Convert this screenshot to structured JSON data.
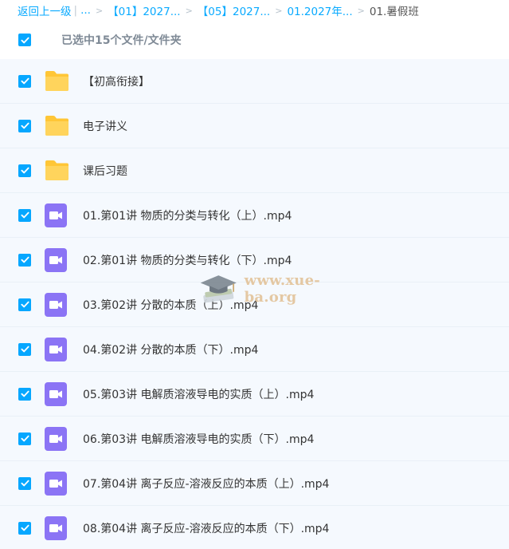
{
  "breadcrumb": {
    "back_label": "返回上一级",
    "ellipsis": "...",
    "crumbs": [
      "【01】2027...",
      "【05】2027...",
      "01.2027年..."
    ],
    "current": "01.暑假班"
  },
  "selection": {
    "label": "已选中15个文件/文件夹",
    "checked": true
  },
  "files": [
    {
      "name": "【初高衔接】",
      "type": "folder",
      "checked": true
    },
    {
      "name": "电子讲义",
      "type": "folder",
      "checked": true
    },
    {
      "name": "课后习题",
      "type": "folder",
      "checked": true
    },
    {
      "name": "01.第01讲 物质的分类与转化（上）.mp4",
      "type": "video",
      "checked": true
    },
    {
      "name": "02.第01讲 物质的分类与转化（下）.mp4",
      "type": "video",
      "checked": true
    },
    {
      "name": "03.第02讲 分散的本质（上）.mp4",
      "type": "video",
      "checked": true
    },
    {
      "name": "04.第02讲 分散的本质（下）.mp4",
      "type": "video",
      "checked": true
    },
    {
      "name": "05.第03讲 电解质溶液导电的实质（上）.mp4",
      "type": "video",
      "checked": true
    },
    {
      "name": "06.第03讲 电解质溶液导电的实质（下）.mp4",
      "type": "video",
      "checked": true
    },
    {
      "name": "07.第04讲 离子反应-溶液反应的本质（上）.mp4",
      "type": "video",
      "checked": true
    },
    {
      "name": "08.第04讲 离子反应-溶液反应的本质（下）.mp4",
      "type": "video",
      "checked": true
    }
  ],
  "watermark": {
    "text": "www.xue-ba.org"
  },
  "colors": {
    "accent": "#06a7ff",
    "folder": "#ffc94d",
    "video": "#8b74f5",
    "row_bg": "#f5f9fe"
  }
}
